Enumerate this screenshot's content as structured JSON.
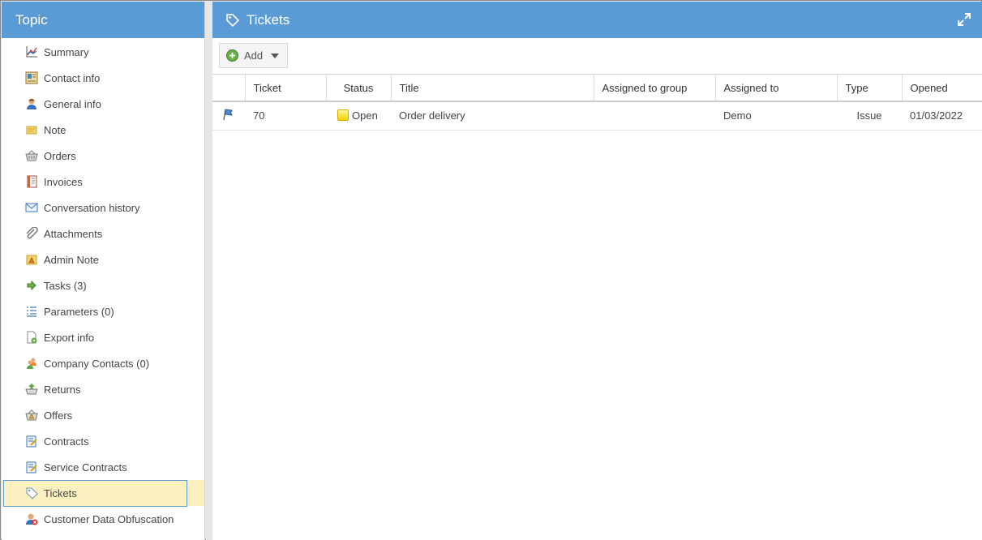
{
  "sidebar": {
    "title": "Topic",
    "items": [
      {
        "label": "Summary",
        "icon": "chart-icon"
      },
      {
        "label": "Contact info",
        "icon": "contact-card-icon"
      },
      {
        "label": "General info",
        "icon": "person-icon"
      },
      {
        "label": "Note",
        "icon": "note-icon"
      },
      {
        "label": "Orders",
        "icon": "basket-icon"
      },
      {
        "label": "Invoices",
        "icon": "invoice-icon"
      },
      {
        "label": "Conversation history",
        "icon": "envelope-icon"
      },
      {
        "label": "Attachments",
        "icon": "paperclip-icon"
      },
      {
        "label": "Admin Note",
        "icon": "admin-note-icon"
      },
      {
        "label": "Tasks (3)",
        "icon": "arrow-right-icon"
      },
      {
        "label": "Parameters (0)",
        "icon": "parameters-list-icon"
      },
      {
        "label": "Export info",
        "icon": "export-document-icon"
      },
      {
        "label": "Company Contacts (0)",
        "icon": "contacts-group-icon"
      },
      {
        "label": "Returns",
        "icon": "return-basket-icon"
      },
      {
        "label": "Offers",
        "icon": "offer-basket-icon"
      },
      {
        "label": "Contracts",
        "icon": "contract-icon"
      },
      {
        "label": "Service Contracts",
        "icon": "service-contract-icon"
      },
      {
        "label": "Tickets",
        "icon": "tag-icon",
        "active": true
      },
      {
        "label": "Customer Data Obfuscation",
        "icon": "obfuscation-person-icon"
      }
    ]
  },
  "main": {
    "title": "Tickets",
    "add_label": "Add",
    "columns": [
      "",
      "Ticket",
      "Status",
      "Title",
      "Assigned to group",
      "Assigned to",
      "Type",
      "Opened"
    ],
    "rows": [
      {
        "ticket": "70",
        "status": "Open",
        "title": "Order delivery",
        "assigned_group": "",
        "assigned_to": "Demo",
        "type": "Issue",
        "opened": "01/03/2022"
      }
    ]
  },
  "colors": {
    "header_blue": "#5b9bd5",
    "active_item_bg": "#fdf1bf",
    "status_open": "#f6d000"
  }
}
